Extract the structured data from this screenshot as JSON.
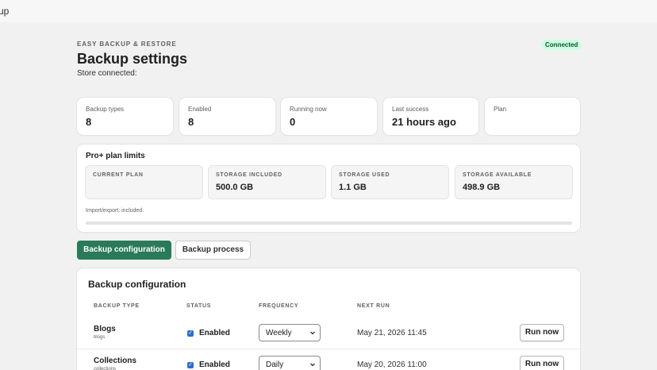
{
  "app": {
    "title": "up"
  },
  "header": {
    "eyebrow": "EASY BACKUP & RESTORE",
    "title": "Backup settings",
    "subtitle": "Store connected:",
    "status": "Connected"
  },
  "stats": [
    {
      "label": "Backup types",
      "value": "8"
    },
    {
      "label": "Enabled",
      "value": "8"
    },
    {
      "label": "Running now",
      "value": "0"
    },
    {
      "label": "Last success",
      "value": "21 hours ago"
    },
    {
      "label": "Plan",
      "value": ""
    }
  ],
  "limits": {
    "title": "Pro+ plan limits",
    "items": [
      {
        "label": "CURRENT PLAN",
        "value": ""
      },
      {
        "label": "STORAGE INCLUDED",
        "value": "500.0 GB"
      },
      {
        "label": "STORAGE USED",
        "value": "1.1 GB"
      },
      {
        "label": "STORAGE AVAILABLE",
        "value": "498.9 GB"
      }
    ],
    "note": "Import/export: included.",
    "usage_fraction": 0.0
  },
  "tabs": [
    {
      "label": "Backup configuration",
      "active": true
    },
    {
      "label": "Backup process",
      "active": false
    }
  ],
  "config": {
    "title": "Backup configuration",
    "columns": [
      "BACKUP TYPE",
      "STATUS",
      "FREQUENCY",
      "NEXT RUN"
    ],
    "rows": [
      {
        "name": "Blogs",
        "key": "blogs",
        "status": "Enabled",
        "frequency": "Weekly",
        "next_run": "May 21, 2026 11:45",
        "action": "Run now"
      },
      {
        "name": "Collections",
        "key": "collections",
        "status": "Enabled",
        "frequency": "Daily",
        "next_run": "May 20, 2026 11:00",
        "action": "Run now"
      }
    ]
  },
  "colors": {
    "primary": "#2a7a5a",
    "badge_bg": "#cdfee1",
    "badge_text": "#0c5132",
    "checkbox": "#2c6ecb"
  }
}
